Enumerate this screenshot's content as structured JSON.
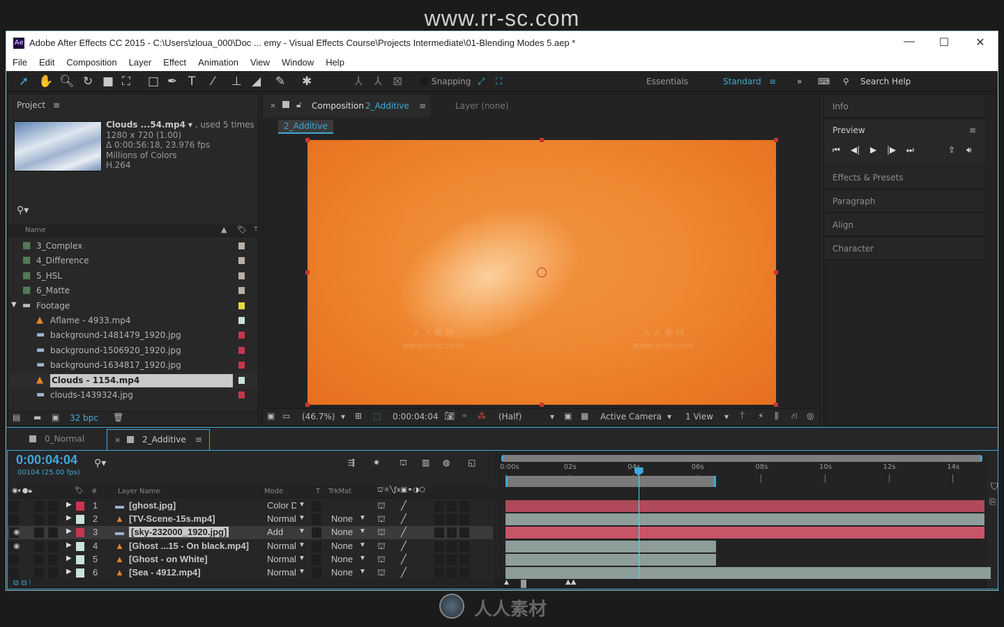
{
  "watermark": {
    "top": "www.rr-sc.com",
    "bottom": "人人素材",
    "overlay_cn": "人 人 素 材",
    "overlay_url": "www.rr-sc.com"
  },
  "window": {
    "title": "Adobe After Effects CC 2015 - C:\\Users\\zloua_000\\Doc ... emy - Visual Effects Course\\Projects Intermediate\\01-Blending Modes 5.aep *",
    "app_icon": "Ae",
    "minimize": "—",
    "maximize": "☐",
    "close": "✕"
  },
  "menu": [
    "File",
    "Edit",
    "Composition",
    "Layer",
    "Effect",
    "Animation",
    "View",
    "Window",
    "Help"
  ],
  "toolbar": {
    "snapping": "Snapping",
    "workspace_essentials": "Essentials",
    "workspace_standard": "Standard",
    "search_help": "Search Help",
    "accent": "#3fa9d9"
  },
  "project": {
    "title": "Project",
    "selected": {
      "name": "Clouds ...54.mp4",
      "used": ", used 5 times",
      "dims": "1280 x 720 (1.00)",
      "duration": "Δ 0:00:56:18, 23.976 fps",
      "colors": "Millions of Colors",
      "codec": "H.264"
    },
    "column_name": "Name",
    "column_t": "T",
    "bpc": "32 bpc",
    "items": [
      {
        "label": "3_Complex",
        "type": "comp",
        "color": "#b9b0a6",
        "indent": 0
      },
      {
        "label": "4_Difference",
        "type": "comp",
        "color": "#b9b0a6",
        "indent": 0
      },
      {
        "label": "5_HSL",
        "type": "comp",
        "color": "#b9b0a6",
        "indent": 0
      },
      {
        "label": "6_Matte",
        "type": "comp",
        "color": "#b9b0a6",
        "indent": 0
      },
      {
        "label": "Footage",
        "type": "folder",
        "color": "#e8d836",
        "indent": 0
      },
      {
        "label": "Aflame - 4933.mp4",
        "type": "video",
        "color": "#c9e2dc",
        "indent": 1
      },
      {
        "label": "background-1481479_1920.jpg",
        "type": "image",
        "color": "#c9354f",
        "indent": 1
      },
      {
        "label": "background-1506920_1920.jpg",
        "type": "image",
        "color": "#c9354f",
        "indent": 1
      },
      {
        "label": "background-1634817_1920.jpg",
        "type": "image",
        "color": "#c9354f",
        "indent": 1
      },
      {
        "label": "Clouds - 1154.mp4",
        "type": "video",
        "color": "#c9e2dc",
        "indent": 1,
        "selected": true
      },
      {
        "label": "clouds-1439324.jpg",
        "type": "image",
        "color": "#c9354f",
        "indent": 1
      }
    ]
  },
  "composition": {
    "tab_label": "Composition",
    "tab_name": "2_Additive",
    "layer_tab": "Layer (none)",
    "breadcrumb": "2_Additive",
    "zoom": "(46.7%)",
    "timecode": "0:00:04:04",
    "resolution": "(Half)",
    "camera": "Active Camera",
    "views": "1 View"
  },
  "right_panels": {
    "info": "Info",
    "preview": "Preview",
    "effects": "Effects & Presets",
    "paragraph": "Paragraph",
    "align": "Align",
    "character": "Character"
  },
  "timeline": {
    "tabs": [
      {
        "label": "0_Normal"
      },
      {
        "label": "2_Additive",
        "active": true
      }
    ],
    "timecode": "0:00:04:04",
    "frame_info": "00104 (25.00 fps)",
    "headers": {
      "layer_name": "Layer Name",
      "mode": "Mode",
      "t": "T",
      "trkmat": "TrkMat"
    },
    "ruler": [
      "0:00s",
      "02s",
      "04s",
      "06s",
      "08s",
      "10s",
      "12s",
      "14s"
    ],
    "duration_s": 15,
    "playhead_s": 4.16,
    "work_area_s": [
      0,
      6.6
    ],
    "layers": [
      {
        "num": "1",
        "name": "[ghost.jpg]",
        "type": "image",
        "label_color": "#c9354f",
        "mode": "Color D",
        "trkmat": "",
        "bar": [
          0,
          15
        ],
        "bar_color": "#b04a5a"
      },
      {
        "num": "2",
        "name": "[TV-Scene-15s.mp4]",
        "type": "video",
        "label_color": "#c9e2dc",
        "mode": "Normal",
        "trkmat": "None",
        "bar": [
          0,
          15
        ],
        "bar_color": "#8d9d9a"
      },
      {
        "num": "3",
        "name": "[sky-232000_1920.jpg]",
        "type": "image",
        "label_color": "#c9354f",
        "mode": "Add",
        "trkmat": "None",
        "bar": [
          0,
          15
        ],
        "bar_color": "#c85468",
        "selected": true
      },
      {
        "num": "4",
        "name": "[Ghost ...15 - On black.mp4]",
        "type": "video",
        "label_color": "#c9e2dc",
        "mode": "Normal",
        "trkmat": "None",
        "bar": [
          0,
          6.6
        ],
        "bar_color": "#8d9d9a",
        "visible": true
      },
      {
        "num": "5",
        "name": "[Ghost - on White]",
        "type": "video",
        "label_color": "#c9e2dc",
        "mode": "Normal",
        "trkmat": "None",
        "bar": [
          0,
          6.6
        ],
        "bar_color": "#8d9d9a"
      },
      {
        "num": "6",
        "name": "[Sea - 4912.mp4]",
        "type": "video",
        "label_color": "#c9e2dc",
        "mode": "Normal",
        "trkmat": "None",
        "bar": [
          0,
          15.2
        ],
        "bar_color": "#8d9d9a"
      }
    ]
  }
}
